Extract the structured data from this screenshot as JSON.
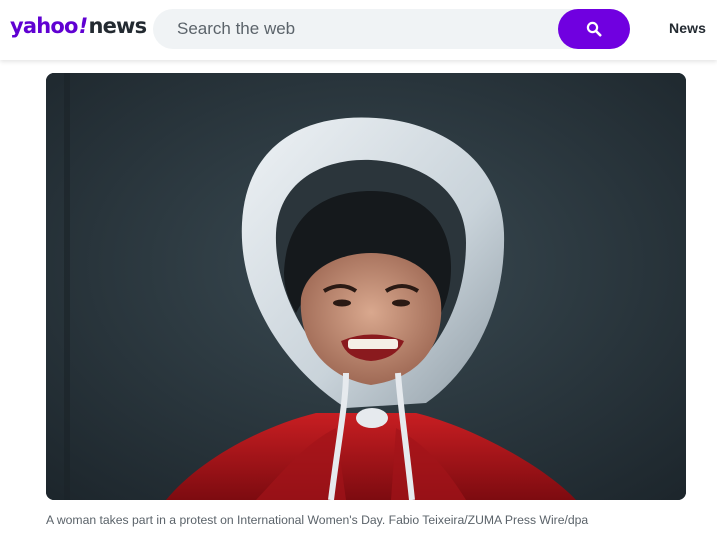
{
  "header": {
    "logo": {
      "brand": "yahoo",
      "bang": "!",
      "section": "news"
    },
    "search": {
      "placeholder": "Search the web",
      "button_icon": "search-icon"
    },
    "nav": {
      "news_label": "News"
    }
  },
  "article": {
    "photo": {
      "icon": "photo-image"
    },
    "caption": "A woman takes part in a protest on International Women's Day. Fabio Teixeira/ZUMA Press Wire/dpa"
  },
  "colors": {
    "brand_purple": "#6001d2",
    "search_button": "#7000e0",
    "search_background": "#f0f3f5",
    "caption_text": "#5b636a"
  }
}
